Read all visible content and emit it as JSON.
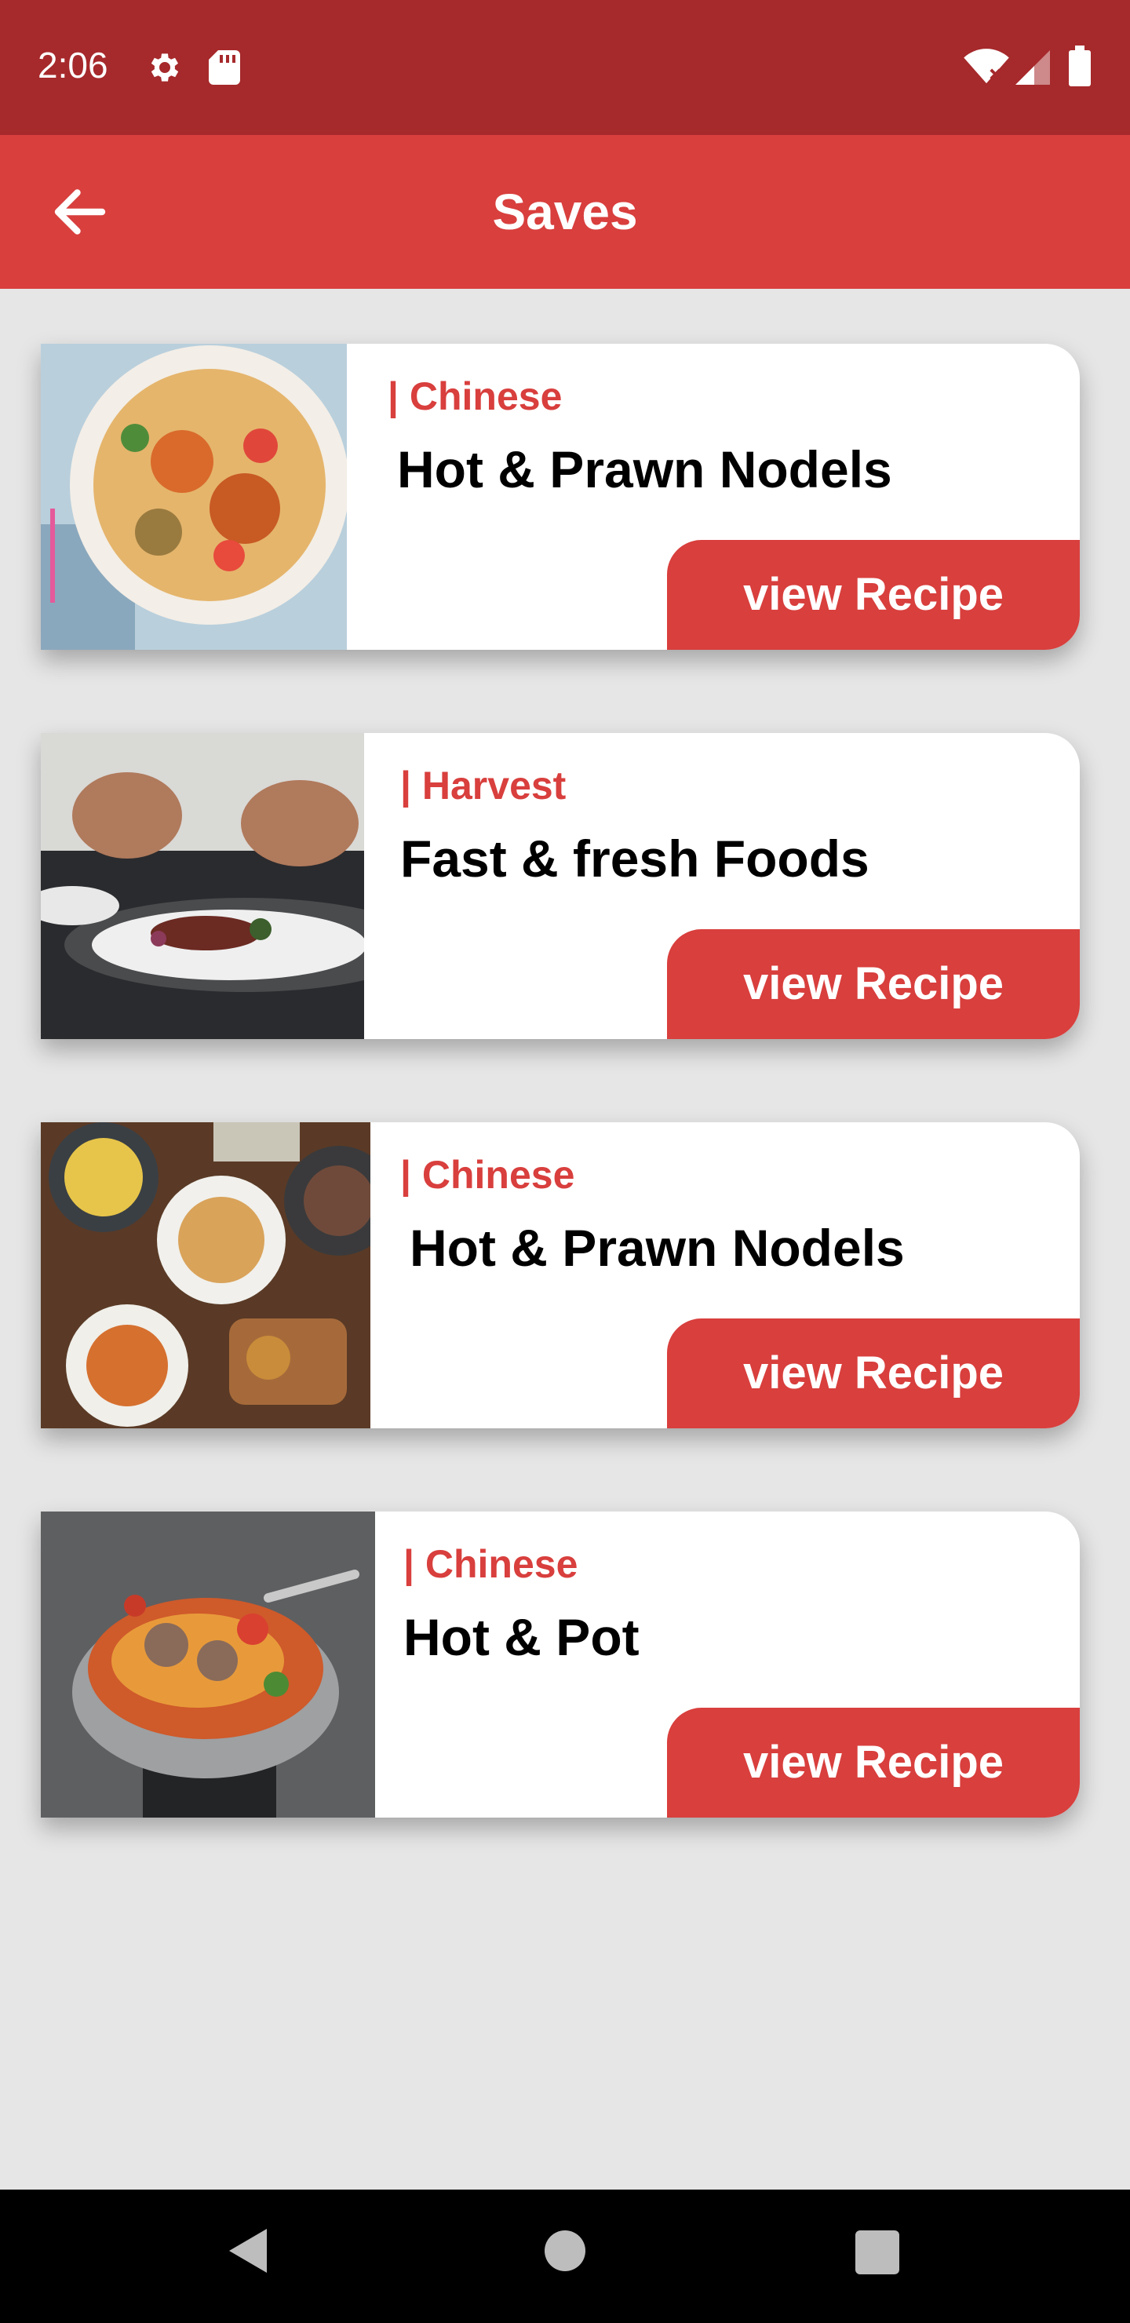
{
  "status_bar": {
    "time": "2:06",
    "icons": [
      "gear-icon",
      "sd-card-icon",
      "wifi-icon",
      "signal-icon",
      "battery-icon"
    ]
  },
  "app_bar": {
    "title": "Saves",
    "back_icon": "arrow-left-icon"
  },
  "colors": {
    "status_bar": "#a6292b",
    "accent": "#d83f3d",
    "background": "#e6e6e6",
    "card": "#ffffff"
  },
  "cards": [
    {
      "category": "| Chinese",
      "title": "Hot & Prawn Nodels",
      "button": "view Recipe"
    },
    {
      "category": "| Harvest",
      "title": "Fast & fresh Foods",
      "button": "view Recipe"
    },
    {
      "category": "| Chinese",
      "title": "Hot & Prawn Nodels",
      "button": "view Recipe"
    },
    {
      "category": "| Chinese",
      "title": "Hot & Pot",
      "button": "view Recipe"
    }
  ],
  "nav_bar": {
    "icons": [
      "back-triangle-icon",
      "home-circle-icon",
      "recents-square-icon"
    ]
  }
}
